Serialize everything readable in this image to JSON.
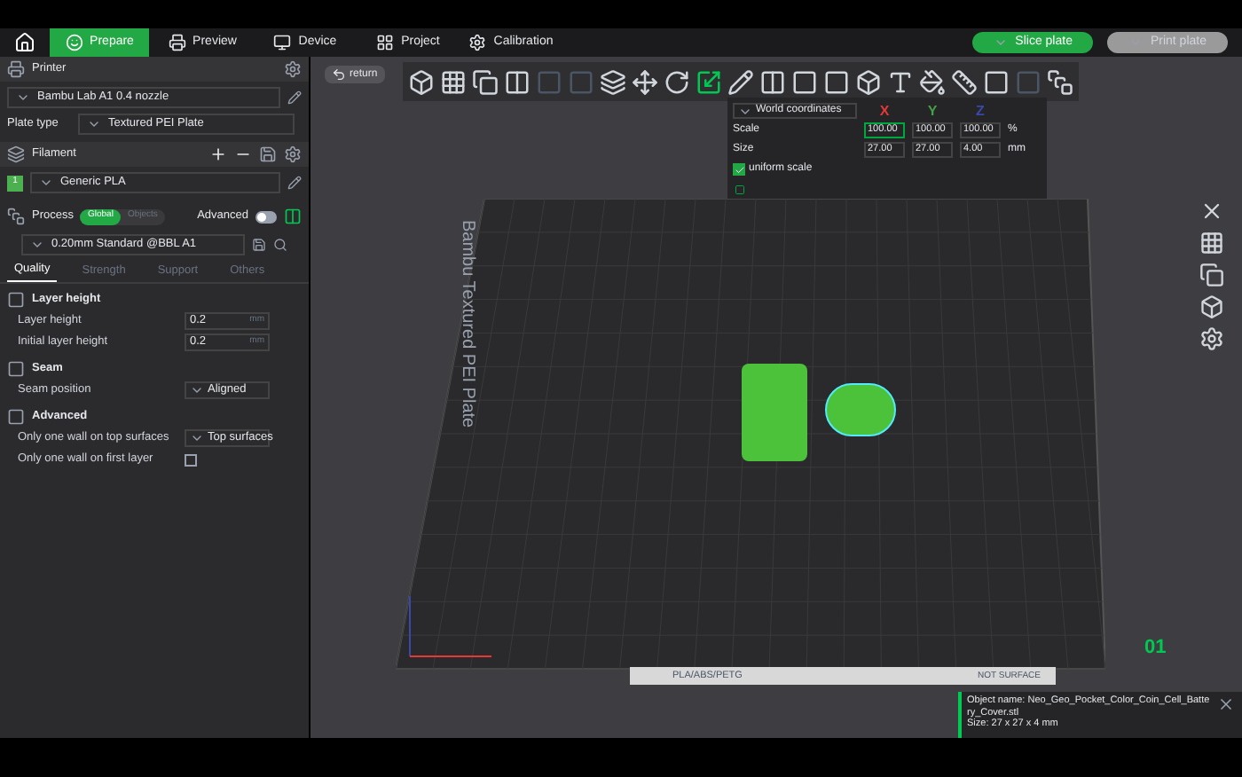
{
  "tabs": [
    {
      "label": "Prepare",
      "selected": true
    },
    {
      "label": "Preview",
      "selected": false
    },
    {
      "label": "Device",
      "selected": false
    },
    {
      "label": "Project",
      "selected": false
    },
    {
      "label": "Calibration",
      "selected": false
    }
  ],
  "actions": [
    {
      "label": "Slice plate",
      "disabled": false
    },
    {
      "label": "Print plate",
      "disabled": true
    }
  ],
  "sidebar": {
    "printer": {
      "title": "Printer",
      "name": "Bambu Lab A1 0.4 nozzle",
      "plate_label": "Plate type",
      "plate_value": "Textured PEI Plate"
    },
    "filament": {
      "title": "Filament",
      "slots": [
        {
          "number": "1",
          "name": "Generic PLA",
          "color": "#4caf50"
        }
      ]
    },
    "process": {
      "title": "Process",
      "modes": [
        {
          "label": "Global",
          "selected": true
        },
        {
          "label": "Objects",
          "selected": false
        }
      ],
      "advanced_label": "Advanced",
      "advanced_on": false,
      "preset": "0.20mm Standard @BBL A1"
    },
    "process_tabs": [
      {
        "label": "Quality",
        "selected": true
      },
      {
        "label": "Strength",
        "selected": false
      },
      {
        "label": "Support",
        "selected": false
      },
      {
        "label": "Others",
        "selected": false
      }
    ],
    "groups": [
      {
        "title": "Layer height",
        "rows": [
          {
            "kind": "input",
            "label": "Layer height",
            "value": "0.2",
            "unit": "mm"
          },
          {
            "kind": "input",
            "label": "Initial layer height",
            "value": "0.2",
            "unit": "mm"
          }
        ]
      },
      {
        "title": "Seam",
        "rows": [
          {
            "kind": "select",
            "label": "Seam position",
            "value": "Aligned"
          }
        ]
      },
      {
        "title": "Advanced",
        "rows": [
          {
            "kind": "select",
            "label": "Only one wall on top surfaces",
            "value": "Top surfaces"
          },
          {
            "kind": "checkbox",
            "label": "Only one wall on first layer",
            "checked": false
          }
        ]
      }
    ]
  },
  "canvas": {
    "return_label": "return",
    "transform_panel": {
      "coords": "World coordinates",
      "axes": [
        {
          "label": "X",
          "color": "#e53935"
        },
        {
          "label": "Y",
          "color": "#43a047"
        },
        {
          "label": "Z",
          "color": "#3949ab"
        }
      ],
      "rows": [
        {
          "label": "Scale",
          "values": [
            "100.00",
            "100.00",
            "100.00"
          ],
          "unit": "%"
        },
        {
          "label": "Size",
          "values": [
            "27.00",
            "27.00",
            "4.00"
          ],
          "unit": "mm"
        }
      ],
      "uniform_label": "uniform scale",
      "uniform_checked": true
    },
    "plate_label": "Bambu Textured PEI Plate",
    "plate_number": "01",
    "plate_strip": {
      "materials": "PLA/ABS/PETG",
      "surface": "NOT SURFACE"
    },
    "notice": {
      "lines": [
        "Object name: Neo_Geo_Pocket_Color_Coin_Cell_Batte",
        "ry_Cover.stl",
        "Size: 27 x 27 x 4 mm"
      ]
    }
  }
}
